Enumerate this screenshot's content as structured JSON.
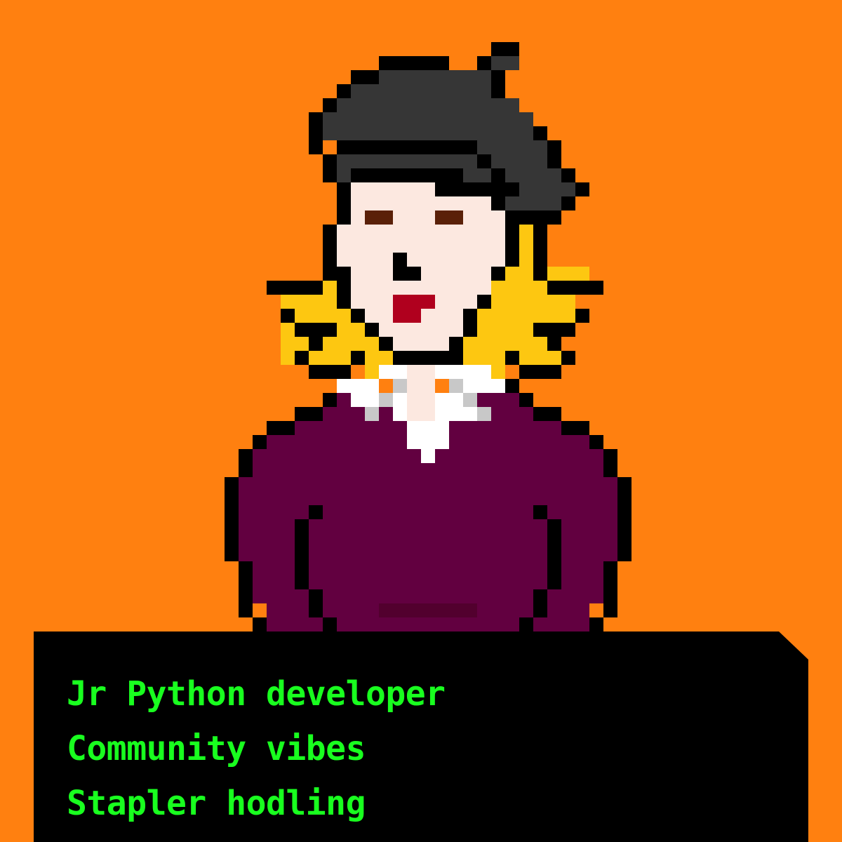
{
  "colors": {
    "background": "#FF8010",
    "panel": "#000000",
    "text": "#19FF1F",
    "outline": "#000000",
    "hair": "#363636",
    "skin": "#FCE8E0",
    "eyes": "#5A2008",
    "lips": "#B0001E",
    "blonde": "#FDC711",
    "collar": "#FFFFFF",
    "collar_shadow": "#C8C8C8",
    "sweater": "#620040",
    "pocket": "#52002E"
  },
  "character": {
    "image": "pixel-art-character-portrait"
  },
  "traits": [
    "Jr Python developer",
    "Community vibes",
    "Stapler hodling"
  ]
}
